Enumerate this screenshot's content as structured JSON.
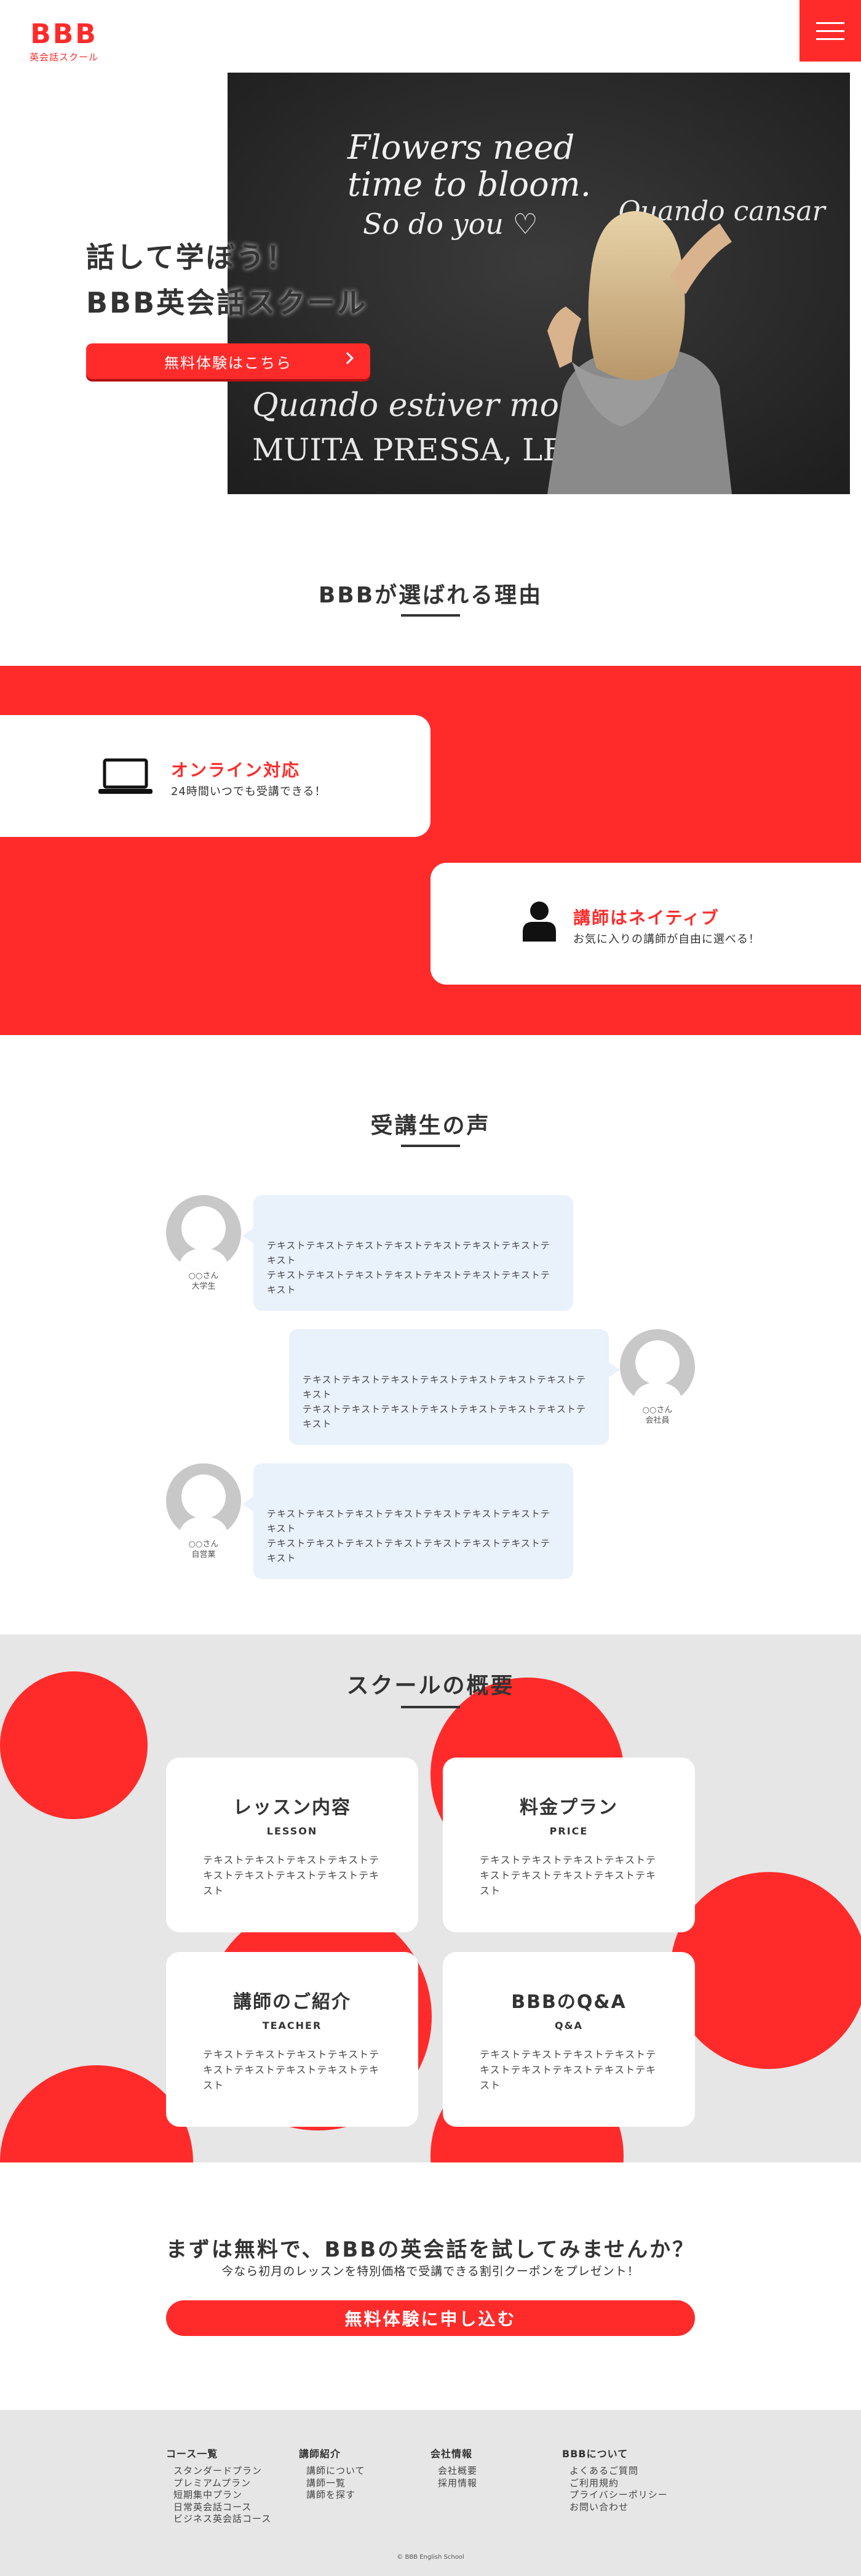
{
  "header": {
    "logo_main": "BBB",
    "logo_sub": "英会話スクール"
  },
  "hero": {
    "title_line1": "話して学ぼう！",
    "title_line2": "BBB英会話スクール",
    "cta_label": "無料体験はこちら",
    "chalk_line1": "Flowers need",
    "chalk_line2": "time to bloom.",
    "chalk_line3": "So do you ♡",
    "chalk_line4": "Quando cansar",
    "chalk_line5": "Quando estiver mo",
    "chalk_line6": "MUITA PRESSA, LEMBRE"
  },
  "reasons": {
    "title": "BBBが選ばれる理由",
    "items": [
      {
        "title": "オンライン対応",
        "sub": "24時間いつでも受講できる！",
        "icon": "laptop-icon"
      },
      {
        "title": "講師はネイティブ",
        "sub": "お気に入りの講師が自由に選べる！",
        "icon": "person-icon"
      }
    ]
  },
  "voices": {
    "title": "受講生の声",
    "items": [
      {
        "name": "○○さん",
        "role": "大学生",
        "text": "テキストテキストテキストテキストテキストテキストテキストテキスト\nテキストテキストテキストテキストテキストテキストテキストテキスト"
      },
      {
        "name": "○○さん",
        "role": "会社員",
        "text": "テキストテキストテキストテキストテキストテキストテキストテキスト\nテキストテキストテキストテキストテキストテキストテキストテキスト"
      },
      {
        "name": "○○さん",
        "role": "自営業",
        "text": "テキストテキストテキストテキストテキストテキストテキストテキスト\nテキストテキストテキストテキストテキストテキストテキストテキスト"
      }
    ]
  },
  "overview": {
    "title": "スクールの概要",
    "cards": [
      {
        "title": "レッスン内容",
        "en": "LESSON",
        "desc": "テキストテキストテキストテキストテキストテキストテキストテキストテキスト"
      },
      {
        "title": "料金プラン",
        "en": "PRICE",
        "desc": "テキストテキストテキストテキストテキストテキストテキストテキストテキスト"
      },
      {
        "title": "講師のご紹介",
        "en": "TEACHER",
        "desc": "テキストテキストテキストテキストテキストテキストテキストテキストテキスト"
      },
      {
        "title": "BBBのQ&A",
        "en": "Q&A",
        "desc": "テキストテキストテキストテキストテキストテキストテキストテキストテキスト"
      }
    ]
  },
  "cta": {
    "title": "まずは無料で、BBBの英会話を試してみませんか？",
    "sub": "今なら初月のレッスンを特別価格で受講できる割引クーポンをプレゼント！",
    "button": "無料体験に申し込む"
  },
  "footer": {
    "columns": [
      {
        "head": "コース一覧",
        "items": [
          "スタンダードプラン",
          "プレミアムプラン",
          "短期集中プラン",
          "日常英会話コース",
          "ビジネス英会話コース"
        ]
      },
      {
        "head": "講師紹介",
        "items": [
          "講師について",
          "講師一覧",
          "講師を探す"
        ]
      },
      {
        "head": "会社情報",
        "items": [
          "会社概要",
          "採用情報"
        ]
      },
      {
        "head": "BBBについて",
        "items": [
          "よくあるご質問",
          "ご利用規約",
          "プライバシーポリシー",
          "お問い合わせ"
        ]
      }
    ],
    "copyright": "© BBB English School"
  },
  "colors": {
    "accent": "#ff2b2b",
    "bubble": "#e9f1fb",
    "band_gray": "#e6e6e6"
  }
}
